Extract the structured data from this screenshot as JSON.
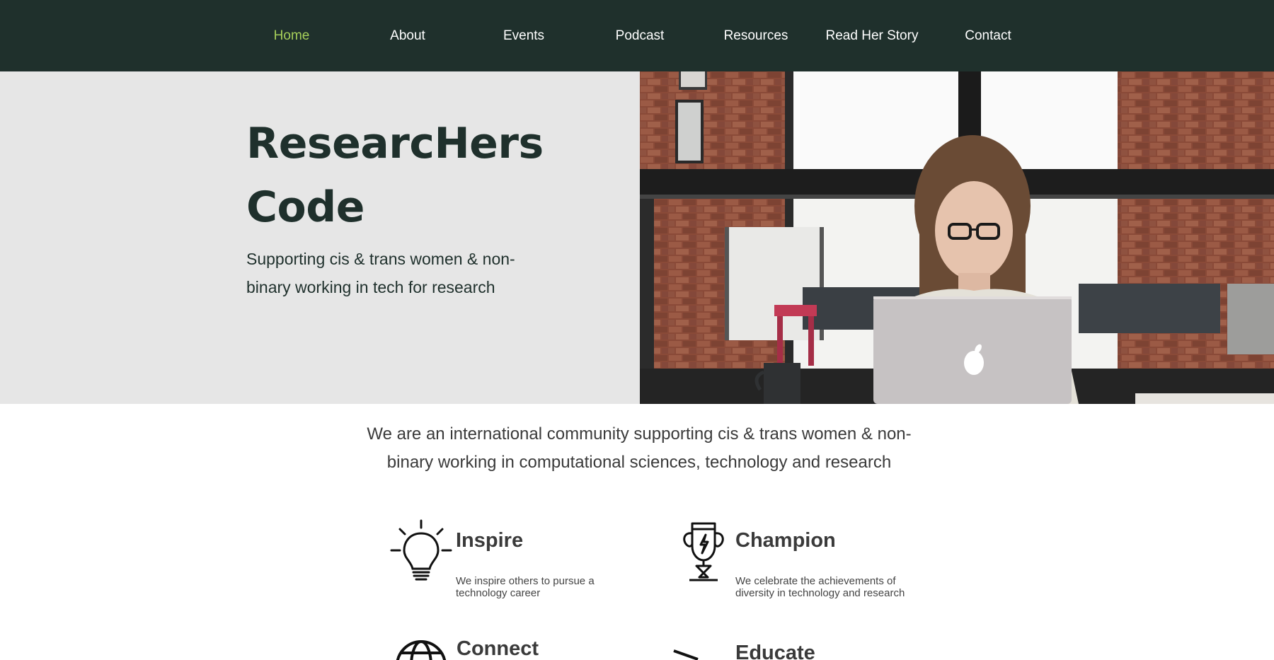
{
  "nav": {
    "items": [
      {
        "label": "Home",
        "active": true
      },
      {
        "label": "About",
        "active": false
      },
      {
        "label": "Events",
        "active": false
      },
      {
        "label": "Podcast",
        "active": false
      },
      {
        "label": "Resources",
        "active": false
      },
      {
        "label": "Read Her Story",
        "active": false
      },
      {
        "label": "Contact",
        "active": false
      }
    ]
  },
  "hero": {
    "title_line1": "ResearcHers",
    "title_line2": "Code",
    "subtitle": "Supporting cis & trans women & non-binary working in tech for research"
  },
  "intro": {
    "text": "We are an international community supporting cis & trans women & non-binary working in computational sciences, technology and research"
  },
  "features": [
    {
      "title": "Inspire",
      "description": "We inspire others to pursue a technology career",
      "icon": "lightbulb-icon"
    },
    {
      "title": "Champion",
      "description": "We celebrate the achievements of diversity in technology and research",
      "icon": "trophy-icon"
    },
    {
      "title": "Connect",
      "description": "",
      "icon": "globe-icon"
    },
    {
      "title": "Educate",
      "description": "",
      "icon": "education-icon"
    }
  ],
  "colors": {
    "nav_bg": "#1f302c",
    "nav_active": "#a6cf5a",
    "hero_bg": "#e6e6e6",
    "heading": "#1f302c"
  }
}
